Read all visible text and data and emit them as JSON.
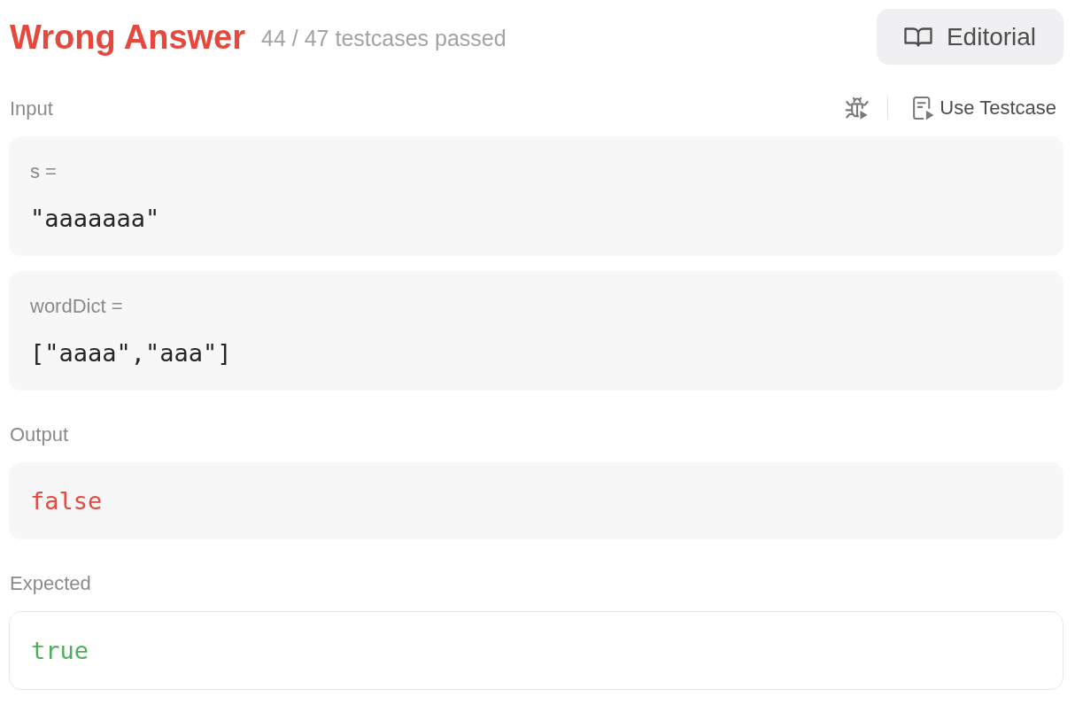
{
  "verdict": {
    "accepted": false,
    "title": "Wrong Answer",
    "summary": "44 / 47 testcases passed"
  },
  "editorial_button": {
    "label": "Editorial"
  },
  "input": {
    "label": "Input",
    "use_testcase_button": {
      "label": "Use Testcase"
    },
    "variables": [
      {
        "name": "s =",
        "value": "\"aaaaaaa\""
      },
      {
        "name": "wordDict =",
        "value": "[\"aaaa\",\"aaa\"]"
      }
    ]
  },
  "results": [
    {
      "kind": "output",
      "label": "Output",
      "value": "false"
    },
    {
      "kind": "expected",
      "label": "Expected",
      "value": "true"
    }
  ]
}
